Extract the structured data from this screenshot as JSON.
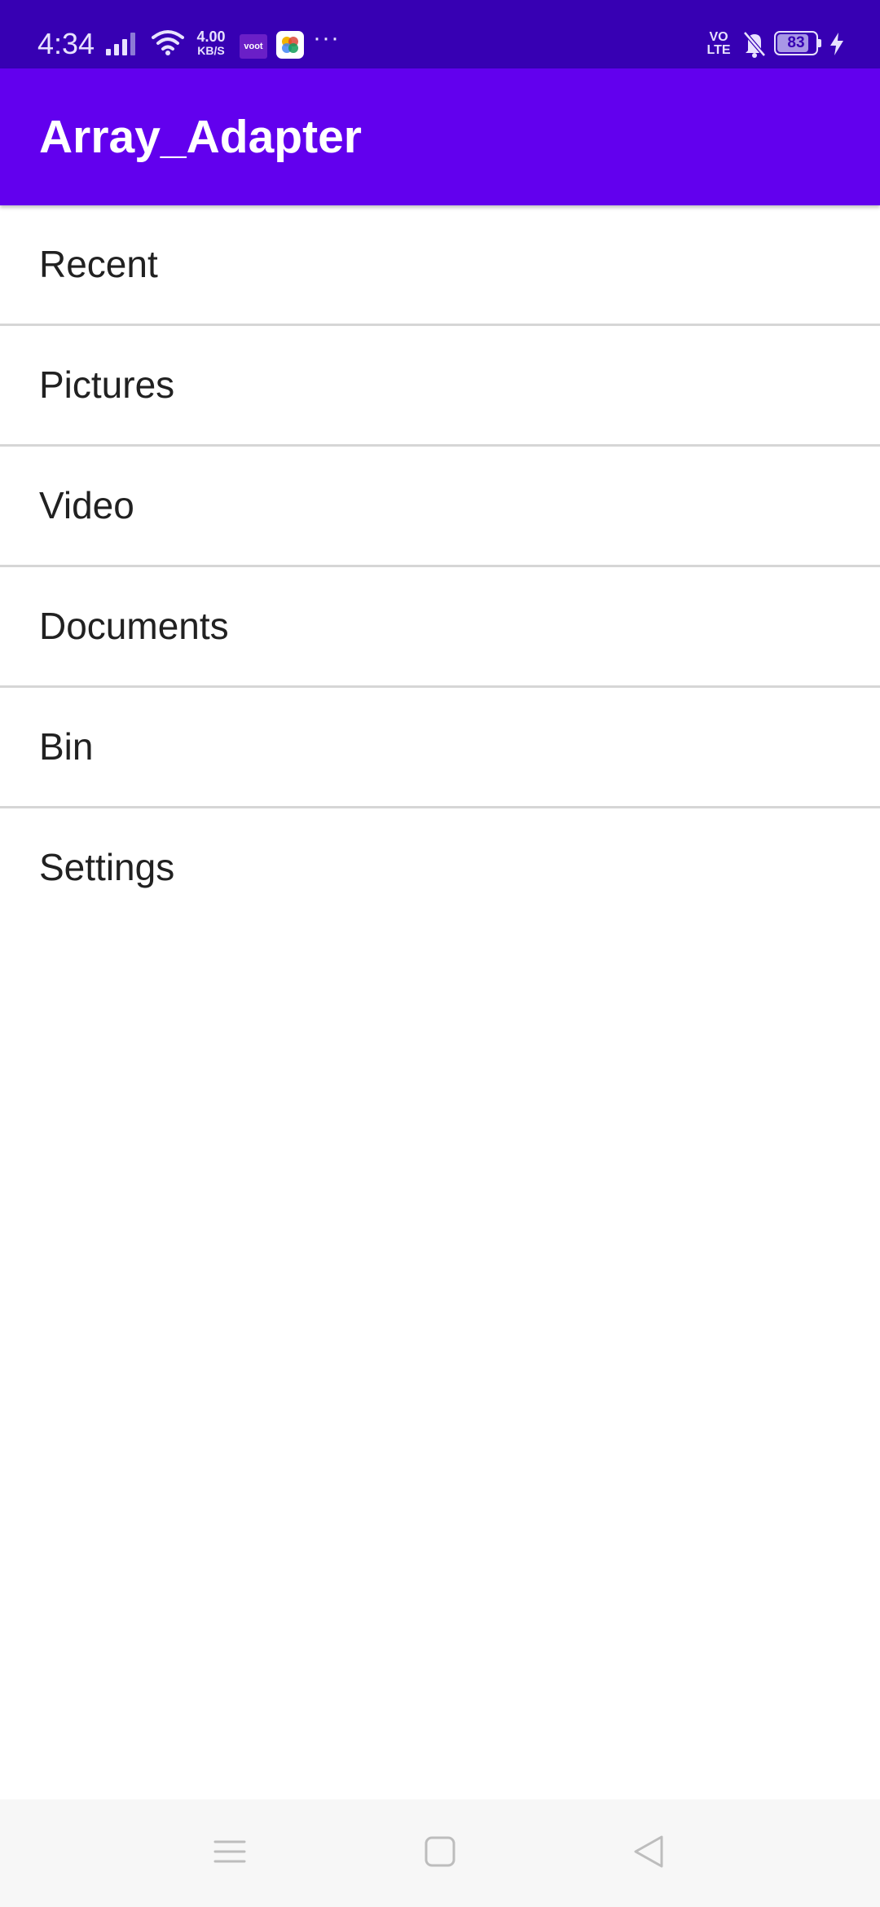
{
  "status_bar": {
    "time": "4:34",
    "speed_value": "4.00",
    "speed_unit": "KB/S",
    "voot_label": "voot",
    "more": "···",
    "volte_top": "VO",
    "volte_bottom": "LTE",
    "battery_level": "83",
    "battery_fraction": 0.83,
    "icons": [
      "signal-icon",
      "wifi-icon",
      "voot-app-icon",
      "app-icon",
      "more-icon",
      "volte-icon",
      "mute-icon",
      "battery-icon",
      "charging-icon"
    ]
  },
  "app_bar": {
    "title": "Array_Adapter"
  },
  "list": {
    "items": [
      {
        "label": "Recent"
      },
      {
        "label": "Pictures"
      },
      {
        "label": "Video"
      },
      {
        "label": "Documents"
      },
      {
        "label": "Bin"
      },
      {
        "label": "Settings"
      }
    ]
  },
  "nav_bar": {
    "icons": [
      "menu-icon",
      "home-icon",
      "back-icon"
    ]
  },
  "colors": {
    "status_bar": "#3700b3",
    "app_bar": "#6200ee",
    "background": "#ffffff",
    "divider": "#d6d6d6",
    "nav_bar": "#f7f7f7",
    "text": "#212121"
  }
}
